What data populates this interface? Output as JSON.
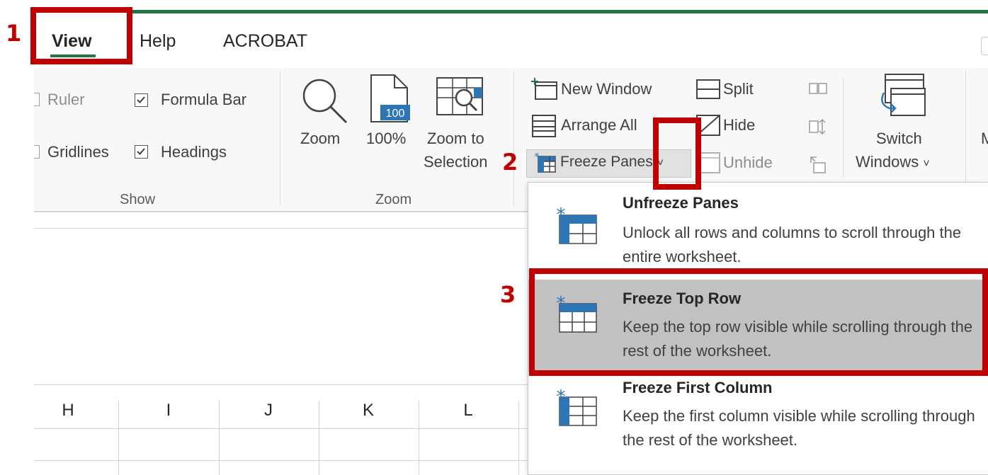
{
  "tabs": {
    "view": "View",
    "help": "Help",
    "acrobat": "ACROBAT"
  },
  "show_group": {
    "ruler": "Ruler",
    "formula_bar": "Formula Bar",
    "gridlines": "Gridlines",
    "headings": "Headings",
    "label": "Show",
    "formula_bar_checked": true,
    "headings_checked": true
  },
  "zoom_group": {
    "zoom": "Zoom",
    "zoom_100": "100%",
    "zoom_100_badge": "100",
    "zoom_to": "Zoom to",
    "selection": "Selection",
    "label": "Zoom"
  },
  "window_group": {
    "new_window": "New Window",
    "arrange_all": "Arrange All",
    "freeze_panes": "Freeze Panes",
    "split": "Split",
    "hide": "Hide",
    "unhide": "Unhide",
    "switch": "Switch",
    "windows": "Windows",
    "chevron": "˅"
  },
  "dropdown": {
    "items": [
      {
        "title": "Unfreeze Panes",
        "desc": "Unlock all rows and columns to scroll through the entire worksheet."
      },
      {
        "title": "Freeze Top Row",
        "desc": "Keep the top row visible while scrolling through the rest of the worksheet."
      },
      {
        "title": "Freeze First Column",
        "desc": "Keep the first column visible while scrolling through the rest of the worksheet."
      }
    ]
  },
  "columns": [
    "H",
    "I",
    "J",
    "K",
    "L"
  ],
  "annotations": {
    "step1": "1",
    "step2": "2",
    "step3": "3"
  },
  "colors": {
    "accent": "#217346",
    "annotation": "#c00000",
    "icon_blue": "#2e75b6"
  }
}
